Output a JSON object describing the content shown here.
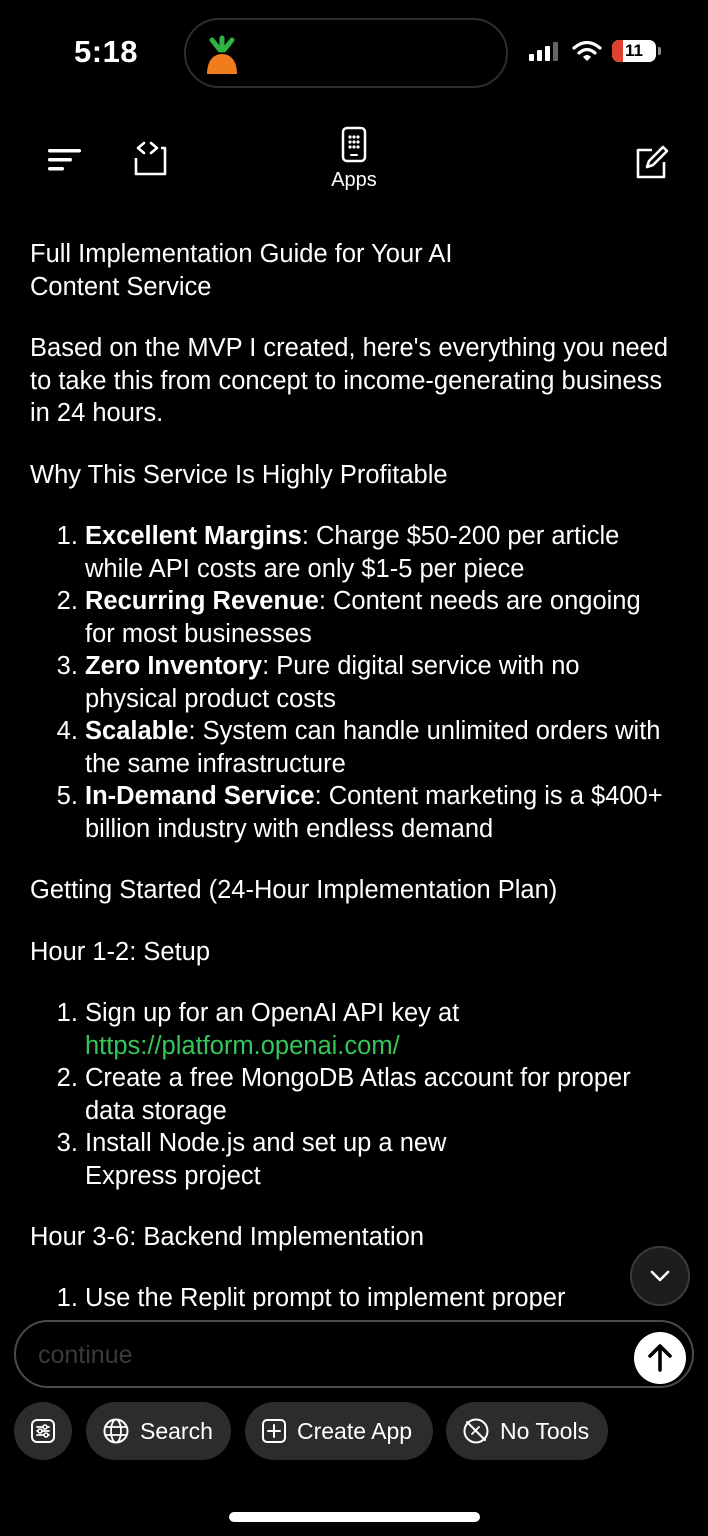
{
  "status_bar": {
    "time": "5:18",
    "battery": "11"
  },
  "header": {
    "apps_label": "Apps"
  },
  "message": {
    "title": "Full Implementation Guide for Your AI Content Service",
    "intro": "Based on the MVP I created, here's everything you need to take this from concept to income-generating business in 24 hours.",
    "section1_heading": "Why This Service Is Highly Profitable",
    "profit_items": [
      {
        "bold": "Excellent Margins",
        "text": ": Charge $50-200 per article while API costs are only $1-5 per piece"
      },
      {
        "bold": "Recurring Revenue",
        "text": ": Content needs are ongoing for most businesses"
      },
      {
        "bold": "Zero Inventory",
        "text": ": Pure digital service with no physical product costs"
      },
      {
        "bold": "Scalable",
        "text": ": System can handle unlimited orders with the same infrastructure"
      },
      {
        "bold": "In-Demand Service",
        "text": ": Content marketing is a $400+ billion industry with endless demand"
      }
    ],
    "section2_heading": "Getting Started (24-Hour Implementation Plan)",
    "hour12_heading": "Hour 1-2: Setup",
    "setup_items": [
      {
        "text": "Sign up for an OpenAI API key at ",
        "link": "https://platform.openai.com/"
      },
      {
        "text": "Create a free MongoDB Atlas account for proper data storage"
      },
      {
        "text": "Install Node.js and set up a new Express project"
      }
    ],
    "hour36_heading": "Hour 3-6: Backend Implementation",
    "backend_items": [
      {
        "text": "Use the Replit prompt to implement proper"
      }
    ]
  },
  "composer": {
    "placeholder": "continue"
  },
  "tools": {
    "search_label": "Search",
    "create_app_label": "Create App",
    "no_tools_label": "No Tools"
  }
}
